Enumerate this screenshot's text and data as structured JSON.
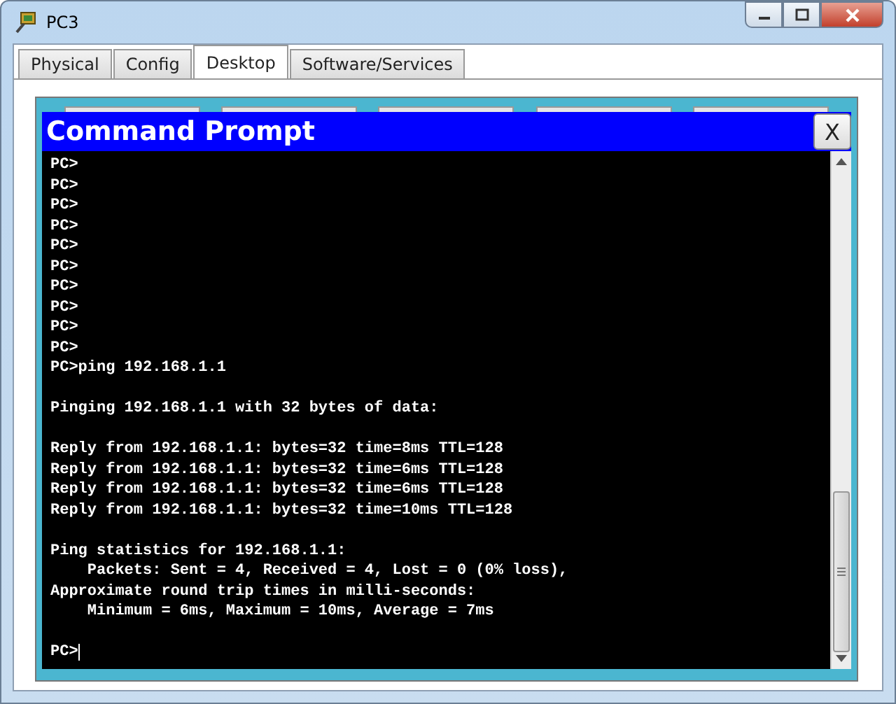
{
  "window": {
    "title": "PC3"
  },
  "tabs": [
    {
      "label": "Physical",
      "selected": false
    },
    {
      "label": "Config",
      "selected": false
    },
    {
      "label": "Desktop",
      "selected": true
    },
    {
      "label": "Software/Services",
      "selected": false
    }
  ],
  "command_prompt": {
    "title": "Command Prompt",
    "close_label": "X",
    "cursor": true,
    "blocks": [
      [
        "PC>",
        "PC>",
        "PC>",
        "PC>",
        "PC>",
        "PC>",
        "PC>",
        "PC>",
        "PC>",
        "PC>",
        "PC>ping 192.168.1.1"
      ],
      [
        "Pinging 192.168.1.1 with 32 bytes of data:"
      ],
      [
        "Reply from 192.168.1.1: bytes=32 time=8ms TTL=128",
        "Reply from 192.168.1.1: bytes=32 time=6ms TTL=128",
        "Reply from 192.168.1.1: bytes=32 time=6ms TTL=128",
        "Reply from 192.168.1.1: bytes=32 time=10ms TTL=128"
      ],
      [
        "Ping statistics for 192.168.1.1:",
        "    Packets: Sent = 4, Received = 4, Lost = 0 (0% loss),",
        "Approximate round trip times in milli-seconds:",
        "    Minimum = 6ms, Maximum = 10ms, Average = 7ms"
      ],
      [
        "PC>"
      ]
    ]
  }
}
